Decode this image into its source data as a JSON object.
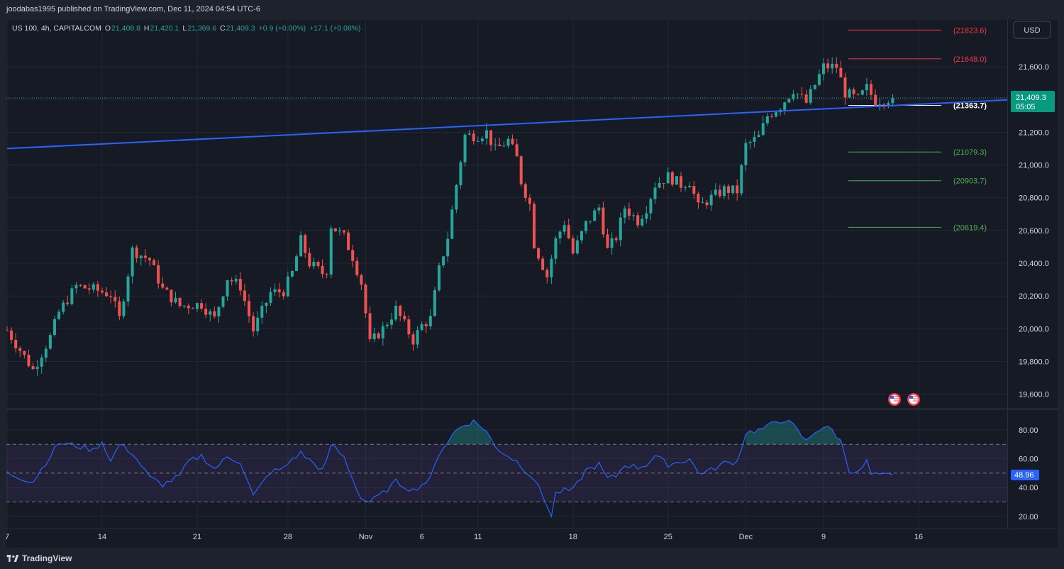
{
  "header": {
    "published": "joodabas1995 published on TradingView.com, Dec 11, 2024 04:54 UTC-6"
  },
  "legend": {
    "symbol": "US 100, 4h, CAPITALCOM",
    "o_label": "O",
    "o": "21,408.8",
    "h_label": "H",
    "h": "21,420.1",
    "l_label": "L",
    "l": "21,369.6",
    "c_label": "C",
    "c": "21,409.3",
    "change": "+0.9 (+0.00%)",
    "extra": "+17.1 (+0.08%)"
  },
  "currency_button": "USD",
  "last_price": {
    "value": "21,409.3",
    "countdown": "05:05"
  },
  "rsi_value": "48.96",
  "footer": {
    "brand": "TradingView"
  },
  "colors": {
    "up": "#26a69a",
    "down": "#ef5350",
    "trendline": "#2962ff",
    "rsi_line": "#2962ff",
    "rsi_band": "#7e57c2",
    "red_level": "#f23645",
    "green_level": "#4caf50",
    "white_level": "#ffffff",
    "badge": "#089981"
  },
  "chart_data": [
    {
      "type": "candlestick",
      "symbol": "US 100",
      "interval": "4h",
      "ylim": [
        19500,
        21900
      ],
      "y_ticks": [
        "21,600.0",
        "21,400.0",
        "21,200.0",
        "21,000.0",
        "20,800.0",
        "20,600.0",
        "20,400.0",
        "20,200.0",
        "20,000.0",
        "19,800.0",
        "19,600.0"
      ],
      "x_ticks": [
        "7",
        "14",
        "21",
        "28",
        "Nov",
        "6",
        "11",
        "18",
        "25",
        "Dec",
        "9",
        "16"
      ],
      "close_path": [
        [
          0,
          19990
        ],
        [
          6,
          19750
        ],
        [
          10,
          19950
        ],
        [
          12,
          20100
        ],
        [
          16,
          20260
        ],
        [
          20,
          20240
        ],
        [
          24,
          20210
        ],
        [
          26,
          20060
        ],
        [
          29,
          20480
        ],
        [
          33,
          20420
        ],
        [
          36,
          20240
        ],
        [
          40,
          20140
        ],
        [
          45,
          20150
        ],
        [
          48,
          20060
        ],
        [
          51,
          20310
        ],
        [
          54,
          20260
        ],
        [
          57,
          19990
        ],
        [
          61,
          20220
        ],
        [
          64,
          20230
        ],
        [
          66,
          20340
        ],
        [
          68,
          20540
        ],
        [
          70,
          20400
        ],
        [
          73,
          20340
        ],
        [
          74,
          20360
        ],
        [
          75,
          20630
        ],
        [
          78,
          20560
        ],
        [
          80,
          20440
        ],
        [
          82,
          20280
        ],
        [
          84,
          19910
        ],
        [
          87,
          20000
        ],
        [
          90,
          20120
        ],
        [
          94,
          19930
        ],
        [
          96,
          20020
        ],
        [
          98,
          20060
        ],
        [
          100,
          20360
        ],
        [
          102,
          20560
        ],
        [
          104,
          20880
        ],
        [
          106,
          21180
        ],
        [
          109,
          21180
        ],
        [
          111,
          21200
        ],
        [
          113,
          21090
        ],
        [
          116,
          21150
        ],
        [
          118,
          21040
        ],
        [
          119,
          20900
        ],
        [
          121,
          20760
        ],
        [
          122,
          20520
        ],
        [
          125,
          20320
        ],
        [
          127,
          20540
        ],
        [
          129,
          20650
        ],
        [
          131,
          20460
        ],
        [
          134,
          20640
        ],
        [
          137,
          20740
        ],
        [
          139,
          20480
        ],
        [
          141,
          20560
        ],
        [
          143,
          20740
        ],
        [
          146,
          20660
        ],
        [
          148,
          20740
        ],
        [
          150,
          20880
        ],
        [
          153,
          20930
        ],
        [
          156,
          20880
        ],
        [
          158,
          20900
        ],
        [
          160,
          20740
        ],
        [
          163,
          20800
        ],
        [
          166,
          20850
        ],
        [
          169,
          20840
        ],
        [
          171,
          21120
        ],
        [
          174,
          21170
        ],
        [
          176,
          21300
        ],
        [
          179,
          21360
        ],
        [
          182,
          21460
        ],
        [
          185,
          21380
        ],
        [
          189,
          21600
        ],
        [
          192,
          21600
        ],
        [
          194,
          21440
        ],
        [
          197,
          21400
        ],
        [
          199,
          21470
        ],
        [
          201,
          21390
        ],
        [
          203,
          21400
        ],
        [
          205,
          21409
        ]
      ],
      "price_levels": [
        {
          "label": "(21823.6)",
          "value": 21823.6,
          "color": "red"
        },
        {
          "label": "(21648.0)",
          "value": 21648.0,
          "color": "red"
        },
        {
          "label": "(21363.7)",
          "value": 21363.7,
          "color": "white"
        },
        {
          "label": "(21079.3)",
          "value": 21079.3,
          "color": "green"
        },
        {
          "label": "(20903.7)",
          "value": 20903.7,
          "color": "green"
        },
        {
          "label": "(20619.4)",
          "value": 20619.4,
          "color": "green"
        }
      ],
      "trendline": {
        "from": [
          0,
          21100
        ],
        "to": [
          230,
          21395
        ]
      },
      "last_price": 21409.3
    },
    {
      "type": "line",
      "name": "RSI",
      "ylim": [
        15,
        85
      ],
      "y_ticks": [
        "80.00",
        "60.00",
        "40.00",
        "20.00"
      ],
      "bands": [
        30,
        50,
        70
      ],
      "path": [
        [
          0,
          50
        ],
        [
          6,
          44
        ],
        [
          10,
          62
        ],
        [
          12,
          71
        ],
        [
          16,
          69
        ],
        [
          20,
          66
        ],
        [
          22,
          72
        ],
        [
          24,
          58
        ],
        [
          26,
          70
        ],
        [
          29,
          64
        ],
        [
          33,
          47
        ],
        [
          36,
          42
        ],
        [
          40,
          48
        ],
        [
          42,
          58
        ],
        [
          45,
          62
        ],
        [
          48,
          53
        ],
        [
          51,
          61
        ],
        [
          54,
          58
        ],
        [
          57,
          34
        ],
        [
          61,
          51
        ],
        [
          64,
          53
        ],
        [
          66,
          60
        ],
        [
          68,
          64
        ],
        [
          70,
          59
        ],
        [
          73,
          52
        ],
        [
          74,
          58
        ],
        [
          75,
          70
        ],
        [
          78,
          61
        ],
        [
          80,
          46
        ],
        [
          82,
          32
        ],
        [
          84,
          30
        ],
        [
          87,
          36
        ],
        [
          90,
          44
        ],
        [
          94,
          38
        ],
        [
          96,
          42
        ],
        [
          98,
          46
        ],
        [
          100,
          64
        ],
        [
          102,
          72
        ],
        [
          104,
          80
        ],
        [
          106,
          84
        ],
        [
          108,
          86
        ],
        [
          110,
          82
        ],
        [
          111,
          79
        ],
        [
          113,
          68
        ],
        [
          116,
          62
        ],
        [
          118,
          58
        ],
        [
          121,
          49
        ],
        [
          122,
          46
        ],
        [
          125,
          28
        ],
        [
          126,
          20
        ],
        [
          127,
          36
        ],
        [
          129,
          38
        ],
        [
          131,
          38
        ],
        [
          134,
          52
        ],
        [
          137,
          56
        ],
        [
          139,
          46
        ],
        [
          141,
          48
        ],
        [
          143,
          56
        ],
        [
          146,
          54
        ],
        [
          148,
          56
        ],
        [
          150,
          62
        ],
        [
          153,
          56
        ],
        [
          156,
          58
        ],
        [
          158,
          60
        ],
        [
          160,
          50
        ],
        [
          163,
          52
        ],
        [
          166,
          57
        ],
        [
          169,
          58
        ],
        [
          171,
          78
        ],
        [
          174,
          80
        ],
        [
          176,
          82
        ],
        [
          178,
          86
        ],
        [
          180,
          87
        ],
        [
          182,
          83
        ],
        [
          185,
          72
        ],
        [
          187,
          79
        ],
        [
          189,
          82
        ],
        [
          191,
          80
        ],
        [
          193,
          72
        ],
        [
          195,
          52
        ],
        [
          197,
          50
        ],
        [
          199,
          58
        ],
        [
          200,
          49
        ],
        [
          202,
          48
        ],
        [
          205,
          49
        ]
      ],
      "last_value": 48.96
    }
  ]
}
